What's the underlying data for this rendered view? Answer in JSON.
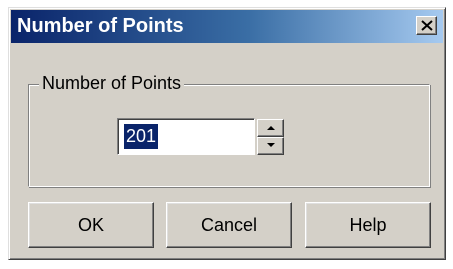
{
  "window": {
    "title": "Number of Points",
    "close_icon": "close-icon"
  },
  "group": {
    "label": "Number of Points"
  },
  "points_input": {
    "value": "201",
    "selected": true,
    "spin_up_icon": "arrow-up-icon",
    "spin_down_icon": "arrow-down-icon"
  },
  "buttons": {
    "ok": "OK",
    "cancel": "Cancel",
    "help": "Help"
  },
  "colors": {
    "titlebar_start": "#0a246a",
    "titlebar_end": "#a6caf0",
    "dialog_face": "#d4d0c8",
    "selection": "#0a246a"
  }
}
